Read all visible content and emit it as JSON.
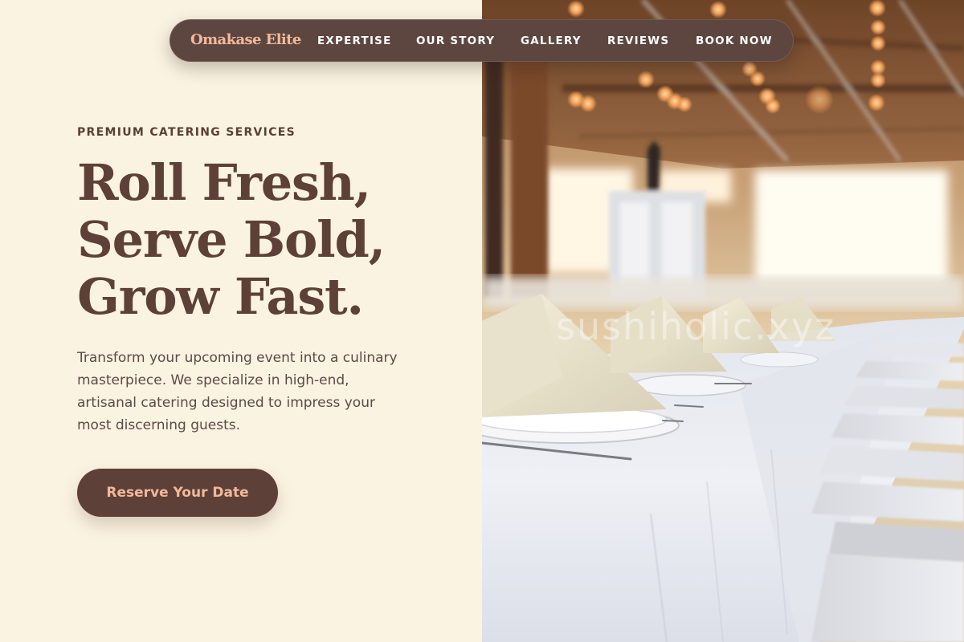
{
  "nav": {
    "brand": "Omakase Elite",
    "items": [
      {
        "label": "EXPERTISE"
      },
      {
        "label": "OUR STORY"
      },
      {
        "label": "GALLERY"
      },
      {
        "label": "REVIEWS"
      },
      {
        "label": "BOOK NOW"
      }
    ]
  },
  "hero": {
    "eyebrow": "PREMIUM CATERING SERVICES",
    "headline_lines": [
      "Roll Fresh,",
      "Serve Bold,",
      "Grow Fast."
    ],
    "description": "Transform your upcoming event into a culinary masterpiece. We specialize in high-end, artisanal catering designed to impress your most discerning guests.",
    "cta_label": "Reserve Your Date"
  },
  "image": {
    "subject": "banquet-hall-photo",
    "watermark": "sushiholic.xyz"
  },
  "colors": {
    "background": "#fbf3e1",
    "primary_brown": "#5d4037",
    "accent_peach": "#f1b99b",
    "body_text": "#5b4a45"
  }
}
